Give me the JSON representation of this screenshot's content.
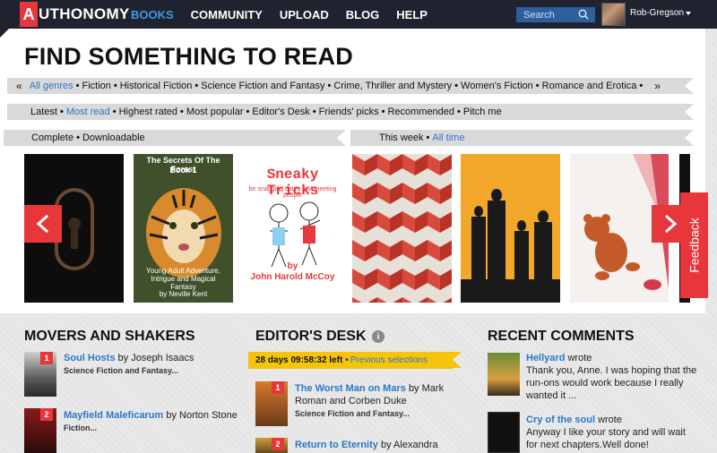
{
  "brand": {
    "logo_letter": "A",
    "logo_rest": "UTHONOMY",
    "accent": "#e8373a",
    "nav_bg": "#1f2330",
    "link": "#2a78c6"
  },
  "nav": {
    "items": [
      {
        "label": "BOOKS",
        "active": true
      },
      {
        "label": "COMMUNITY"
      },
      {
        "label": "UPLOAD"
      },
      {
        "label": "BLOG"
      },
      {
        "label": "HELP"
      }
    ],
    "search_placeholder": "Search",
    "user": "Rob-Gregson"
  },
  "page": {
    "title": "FIND SOMETHING TO READ"
  },
  "genres": {
    "prev": "«",
    "next": "»",
    "items": [
      "All genres",
      "Fiction",
      "Historical Fiction",
      "Science Fiction and Fantasy",
      "Crime, Thriller and Mystery",
      "Women's Fiction",
      "Romance and Erotica"
    ],
    "active": 0
  },
  "sort": {
    "items": [
      "Latest",
      "Most read",
      "Highest rated",
      "Most popular",
      "Editor's Desk",
      "Friends' picks",
      "Recommended",
      "Pitch me"
    ],
    "active": 1
  },
  "filters": {
    "items": [
      "Complete",
      "Downloadable"
    ]
  },
  "period": {
    "items": [
      "This week",
      "All time"
    ],
    "active": 1
  },
  "covers": {
    "c2_title": "The Secrets Of The Forest",
    "c2_sub": "Book 1",
    "c2_blurb": "Young Adult Adventure, Intrigue and Magical Fantasy",
    "c2_author": "by  Neville Kent",
    "c3_title": "Sneaky Tricks",
    "c3_sub": "for snagging dates and meeting people",
    "c3_by": "by",
    "c3_author": "John Harold McCoy"
  },
  "feedback": "Feedback",
  "movers": {
    "title": "MOVERS AND SHAKERS",
    "books": [
      {
        "rank": "1",
        "title": "Soul Hosts",
        "by": "by",
        "author": "Joseph Isaacs",
        "genre": "Science Fiction and Fantasy..."
      },
      {
        "rank": "2",
        "title": "Mayfield Maleficarum",
        "by": "by",
        "author": "Norton Stone",
        "genre": "Fiction..."
      }
    ]
  },
  "editors": {
    "title": "EDITOR'S DESK",
    "info": "i",
    "countdown": "28 days 09:58:32 left",
    "sep": "•",
    "previous": "Previous selections",
    "books": [
      {
        "rank": "1",
        "title": "The Worst Man on Mars",
        "by": "by",
        "author_line1": "Mark",
        "author_line2": "Roman and Corben Duke",
        "genre": "Science Fiction and Fantasy..."
      },
      {
        "rank": "2",
        "title": "Return to Eternity",
        "by": "by",
        "author": "Alexandra"
      }
    ]
  },
  "comments": {
    "title": "RECENT COMMENTS",
    "items": [
      {
        "author": "Hellyard",
        "verb": "wrote",
        "line1": "Thank you, Anne. I was hoping that the",
        "line2": "run-ons would work because I really",
        "line3": "wanted it ..."
      },
      {
        "author": "Cry of the soul",
        "verb": "wrote",
        "line1": "Anyway I like your story and will wait",
        "line2": "for next chapters.Well done!"
      }
    ]
  }
}
